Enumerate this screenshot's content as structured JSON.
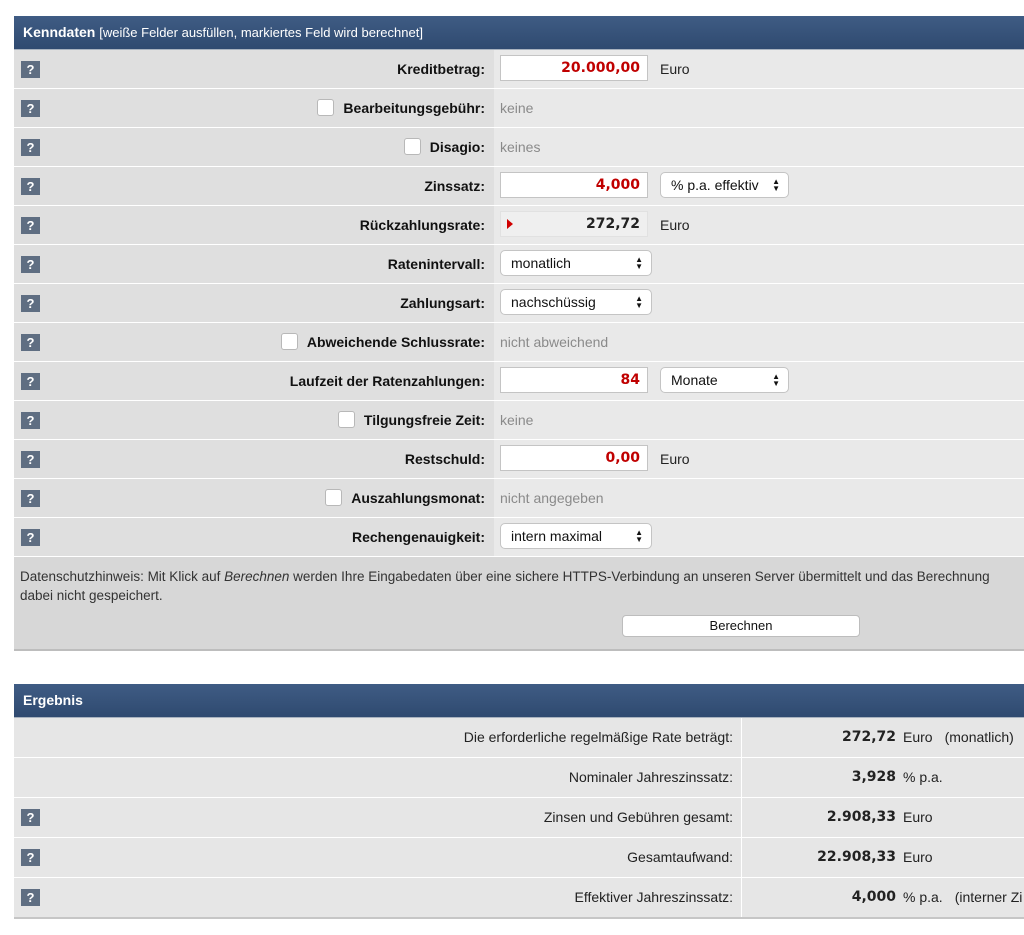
{
  "kenndaten": {
    "title": "Kenndaten",
    "subtitle": "[weiße Felder ausfüllen, markiertes Feld wird berechnet]",
    "help_icon": "?",
    "rows": {
      "kreditbetrag": {
        "label": "Kreditbetrag:",
        "value": "20.000,00",
        "unit": "Euro"
      },
      "bearbeitungsgebuehr": {
        "label": "Bearbeitungsgebühr:",
        "checked": false,
        "value": "keine"
      },
      "disagio": {
        "label": "Disagio:",
        "checked": false,
        "value": "keines"
      },
      "zinssatz": {
        "label": "Zinssatz:",
        "value": "4,000",
        "unit_select": "% p.a. effektiv"
      },
      "rueckzahlungsrate": {
        "label": "Rückzahlungsrate:",
        "value": "272,72",
        "unit": "Euro",
        "calculated": true
      },
      "ratenintervall": {
        "label": "Ratenintervall:",
        "select": "monatlich"
      },
      "zahlungsart": {
        "label": "Zahlungsart:",
        "select": "nachschüssig"
      },
      "schlussrate": {
        "label": "Abweichende Schlussrate:",
        "checked": false,
        "value": "nicht abweichend"
      },
      "laufzeit": {
        "label": "Laufzeit der Ratenzahlungen:",
        "value": "84",
        "unit_select": "Monate"
      },
      "tilgungsfrei": {
        "label": "Tilgungsfreie Zeit:",
        "checked": false,
        "value": "keine"
      },
      "restschuld": {
        "label": "Restschuld:",
        "value": "0,00",
        "unit": "Euro"
      },
      "auszahlungsmonat": {
        "label": "Auszahlungsmonat:",
        "checked": false,
        "value": "nicht angegeben"
      },
      "rechengenauigkeit": {
        "label": "Rechengenauigkeit:",
        "select": "intern maximal"
      }
    },
    "notice": {
      "part1": "Datenschutzhinweis: Mit Klick auf ",
      "emph": "Berechnen",
      "part2": " werden Ihre Eingabedaten über eine sichere HTTPS-Verbindung an unseren Server übermittelt und das Berechnung",
      "line2": "dabei nicht gespeichert."
    },
    "button_label": "Berechnen"
  },
  "ergebnis": {
    "title": "Ergebnis",
    "rows": [
      {
        "label": "Die erforderliche regelmäßige Rate beträgt:",
        "value": "272,72",
        "unit": "Euro",
        "note": "(monatlich)",
        "help": false
      },
      {
        "label": "Nominaler Jahreszinssatz:",
        "value": "3,928",
        "unit": "% p.a.",
        "note": "",
        "help": false
      },
      {
        "label": "Zinsen und Gebühren gesamt:",
        "value": "2.908,33",
        "unit": "Euro",
        "note": "",
        "help": true
      },
      {
        "label": "Gesamtaufwand:",
        "value": "22.908,33",
        "unit": "Euro",
        "note": "",
        "help": true
      },
      {
        "label": "Effektiver Jahreszinssatz:",
        "value": "4,000",
        "unit": "% p.a.",
        "note": "(interner Zi",
        "help": true
      }
    ]
  }
}
